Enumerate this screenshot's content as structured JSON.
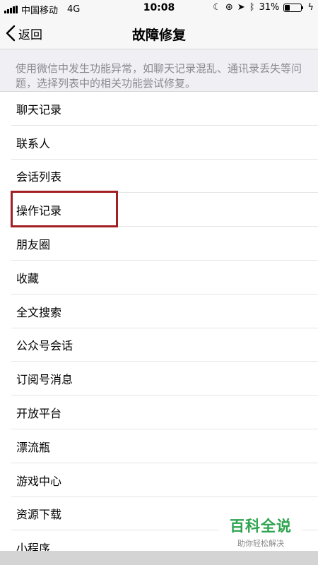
{
  "status_bar": {
    "carrier": "中国移动",
    "network": "4G",
    "time": "10:08",
    "battery_percent": "31%",
    "battery_level": 0.31
  },
  "nav": {
    "back_label": "返回",
    "title": "故障修复"
  },
  "description": "使用微信中发生功能异常，如聊天记录混乱、通讯录丢失等问题，选择列表中的相关功能尝试修复。",
  "list": {
    "items": [
      {
        "label": "聊天记录"
      },
      {
        "label": "联系人"
      },
      {
        "label": "会话列表"
      },
      {
        "label": "操作记录"
      },
      {
        "label": "朋友圈"
      },
      {
        "label": "收藏"
      },
      {
        "label": "全文搜索"
      },
      {
        "label": "公众号会话"
      },
      {
        "label": "订阅号消息"
      },
      {
        "label": "开放平台"
      },
      {
        "label": "漂流瓶"
      },
      {
        "label": "游戏中心"
      },
      {
        "label": "资源下载"
      },
      {
        "label": "小程序"
      }
    ],
    "highlighted_item": "操作记录"
  },
  "watermark": {
    "brand": "百科全说",
    "tagline": "助你轻松解决"
  },
  "colors": {
    "highlight": "#a11f23",
    "watermark_green": "#2ea44f"
  }
}
